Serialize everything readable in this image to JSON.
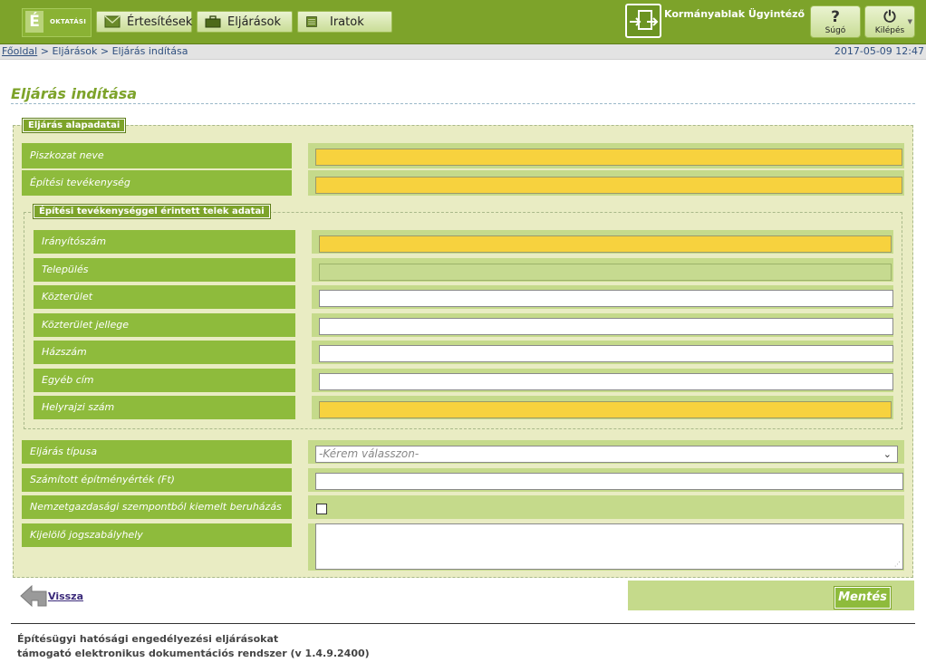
{
  "header": {
    "logo_letter": "É",
    "logo_text": "OKTATÁSI",
    "nav": [
      {
        "label": "Értesítések",
        "icon": "envelope-icon"
      },
      {
        "label": "Eljárások",
        "icon": "briefcase-icon"
      },
      {
        "label": "Iratok",
        "icon": "document-icon"
      }
    ],
    "kormanyablak_label": "Kormányablak Ügyintéző",
    "help": {
      "glyph": "?",
      "label": "Súgó"
    },
    "logout": {
      "glyph": "⏻",
      "label": "Kilépés"
    }
  },
  "breadcrumb": {
    "home": "Főoldal",
    "sep": " > ",
    "items": [
      "Eljárások",
      "Eljárás indítása"
    ],
    "timestamp": "2017-05-09 12:47"
  },
  "page_title": "Eljárás indítása",
  "section": {
    "legend": "Eljárás alapadatai",
    "fields_top": [
      {
        "label": "Piszkozat neve",
        "value": "",
        "state": "required"
      },
      {
        "label": "Építési tevékenység",
        "value": "",
        "state": "required"
      }
    ],
    "subsection": {
      "legend": "Építési tevékenységgel érintett telek adatai",
      "fields": [
        {
          "label": "Irányítószám",
          "value": "",
          "state": "required"
        },
        {
          "label": "Település",
          "value": "",
          "state": "disabled"
        },
        {
          "label": "Közterület",
          "value": "",
          "state": "normal"
        },
        {
          "label": "Közterület jellege",
          "value": "",
          "state": "normal"
        },
        {
          "label": "Házszám",
          "value": "",
          "state": "normal"
        },
        {
          "label": "Egyéb cím",
          "value": "",
          "state": "normal"
        },
        {
          "label": "Helyrajzi szám",
          "value": "",
          "state": "required"
        }
      ]
    },
    "eljaras_tipusa": {
      "label": "Eljárás típusa",
      "selected": "-Kérem válasszon-"
    },
    "szamitott": {
      "label": "Számított építményérték (Ft)",
      "value": ""
    },
    "nemzetgazdasagi": {
      "label": "Nemzetgazdasági szempontból kiemelt beruházás",
      "checked": false
    },
    "kijelolo": {
      "label": "Kijelölő jogszabályhely",
      "value": ""
    }
  },
  "actions": {
    "back": "Vissza",
    "save": "Mentés"
  },
  "footer": {
    "line1": "Építésügyi hatósági engedélyezési eljárásokat",
    "line2": "támogató elektronikus dokumentációs rendszer (v 1.4.9.2400)"
  },
  "colors": {
    "brand": "#7da32a",
    "label_bg": "#8ebb3c",
    "required": "#f7d23e",
    "section_bg": "#e9ecc3"
  }
}
